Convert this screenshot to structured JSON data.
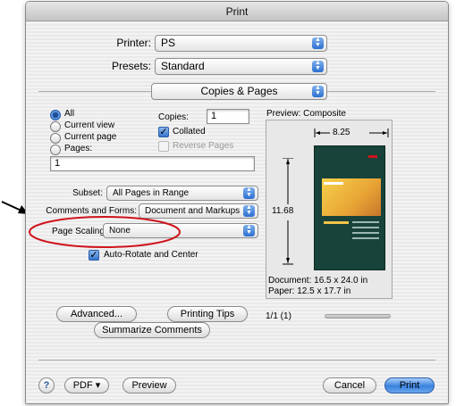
{
  "window": {
    "title": "Print"
  },
  "printer": {
    "label": "Printer:",
    "value": "PS"
  },
  "presets": {
    "label": "Presets:",
    "value": "Standard"
  },
  "panel": {
    "value": "Copies & Pages"
  },
  "pages": {
    "options": [
      "All",
      "Current view",
      "Current page",
      "Pages:"
    ],
    "selected": "All",
    "range_value": "1"
  },
  "copies": {
    "label": "Copies:",
    "value": "1"
  },
  "collated": {
    "label": "Collated",
    "checked": true
  },
  "reverse": {
    "label": "Reverse Pages",
    "checked": false,
    "enabled": false
  },
  "subset": {
    "label": "Subset:",
    "value": "All Pages in Range"
  },
  "comments": {
    "label": "Comments and Forms:",
    "value": "Document and Markups"
  },
  "scaling": {
    "label": "Page Scaling:",
    "value": "None"
  },
  "autorotate": {
    "label": "Auto-Rotate and Center",
    "checked": true
  },
  "preview": {
    "title": "Preview: Composite",
    "width": "8.25",
    "height": "11.68",
    "doc_size": "Document: 16.5 x 24.0 in",
    "paper_size": "Paper: 12.5 x 17.7 in"
  },
  "buttons": {
    "advanced": "Advanced...",
    "tips": "Printing Tips",
    "summarize": "Summarize Comments",
    "help": "?",
    "pdf": "PDF ▾",
    "preview": "Preview",
    "cancel": "Cancel",
    "print": "Print"
  },
  "page_count": "1/1 (1)",
  "colors": {
    "accent": "#3a78cf",
    "highlight_ring": "#d0141c",
    "print_button": "#5b9ae6"
  }
}
